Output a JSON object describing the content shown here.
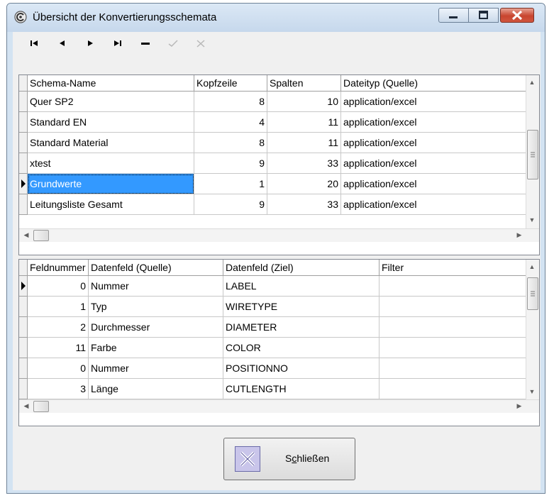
{
  "window": {
    "title": "Übersicht der Konvertierungsschemata",
    "icon": "app-swirl-icon",
    "caption_buttons": [
      "minimize-icon",
      "maximize-icon",
      "close-icon"
    ]
  },
  "navigator": {
    "buttons": [
      {
        "name": "first-record-icon",
        "enabled": true
      },
      {
        "name": "prior-record-icon",
        "enabled": true
      },
      {
        "name": "next-record-icon",
        "enabled": true
      },
      {
        "name": "last-record-icon",
        "enabled": true
      },
      {
        "name": "delete-record-icon",
        "enabled": true
      },
      {
        "name": "post-edit-icon",
        "enabled": false
      },
      {
        "name": "cancel-edit-icon",
        "enabled": false
      }
    ]
  },
  "schema_grid": {
    "columns": [
      "Schema-Name",
      "Kopfzeile",
      "Spalten",
      "Dateityp (Quelle)"
    ],
    "rows": [
      [
        "Quer SP2",
        "8",
        "10",
        "application/excel"
      ],
      [
        "Standard EN",
        "4",
        "11",
        "application/excel"
      ],
      [
        "Standard Material",
        "8",
        "11",
        "application/excel"
      ],
      [
        "xtest",
        "9",
        "33",
        "application/excel"
      ],
      [
        "Grundwerte",
        "1",
        "20",
        "application/excel"
      ],
      [
        "Leitungsliste Gesamt",
        "9",
        "33",
        "application/excel"
      ]
    ],
    "selected_row": 4
  },
  "field_grid": {
    "columns": [
      "Feldnummer",
      "Datenfeld (Quelle)",
      "Datenfeld (Ziel)",
      "Filter"
    ],
    "rows": [
      [
        "0",
        "Nummer",
        "LABEL",
        ""
      ],
      [
        "1",
        "Typ",
        "WIRETYPE",
        ""
      ],
      [
        "2",
        "Durchmesser",
        "DIAMETER",
        ""
      ],
      [
        "11",
        "Farbe",
        "COLOR",
        ""
      ],
      [
        "0",
        "Nummer",
        "POSITIONNO",
        ""
      ],
      [
        "3",
        "Länge",
        "CUTLENGTH",
        ""
      ]
    ],
    "current_row": 0
  },
  "close_button": {
    "label_pre": "S",
    "label_mnemonic": "c",
    "label_post": "hließen",
    "icon": "close-x-icon"
  },
  "colors": {
    "selection": "#3399ff",
    "window_frame": "#d3e3f2",
    "close_caption": "#c8452f"
  }
}
